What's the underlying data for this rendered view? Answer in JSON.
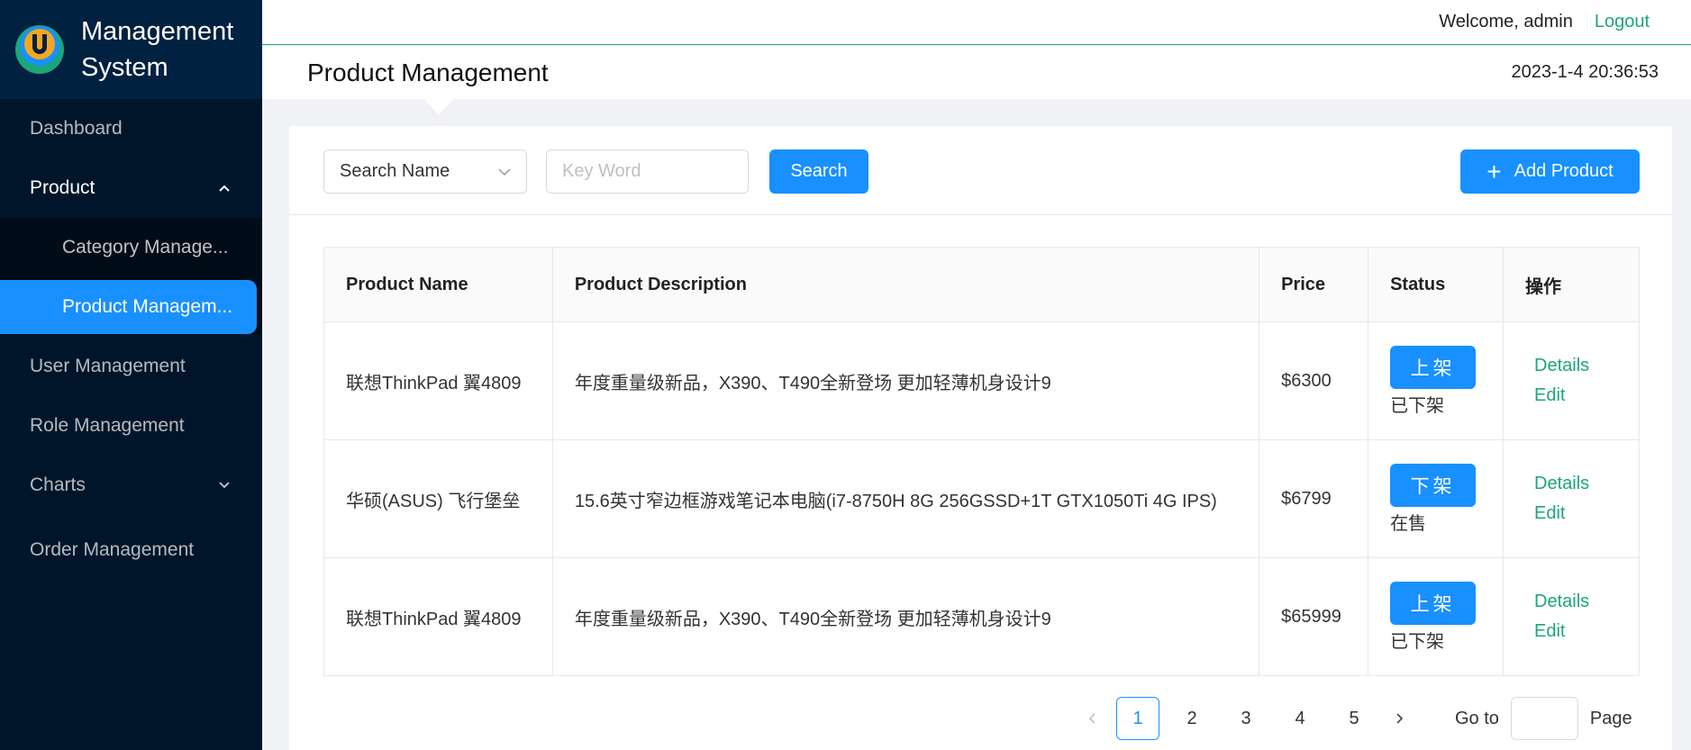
{
  "brand": {
    "title_line1": "Management",
    "title_line2": "System",
    "logo_icon": "u-logo-icon"
  },
  "sidebar": {
    "items": [
      {
        "label": "Dashboard"
      },
      {
        "label": "Product",
        "expanded": true,
        "children": [
          {
            "label": "Category Manage..."
          },
          {
            "label": "Product Managem...",
            "active": true
          }
        ]
      },
      {
        "label": "User Management"
      },
      {
        "label": "Role Management"
      },
      {
        "label": "Charts",
        "expanded": false
      },
      {
        "label": "Order Management"
      }
    ]
  },
  "header": {
    "welcome": "Welcome, admin",
    "logout": "Logout"
  },
  "titlebar": {
    "title": "Product Management",
    "datetime": "2023-1-4 20:36:53"
  },
  "toolbar": {
    "search_type": "Search Name",
    "keyword_placeholder": "Key Word",
    "search_label": "Search",
    "add_label": "Add Product",
    "add_icon": "plus-icon"
  },
  "table": {
    "headers": [
      "Product Name",
      "Product Description",
      "Price",
      "Status",
      "操作"
    ],
    "rows": [
      {
        "name": "联想ThinkPad 翼4809",
        "description": "年度重量级新品，X390、T490全新登场 更加轻薄机身设计9",
        "price": "$6300",
        "status_button": "上架",
        "status_text": "已下架",
        "details": "Details",
        "edit": "Edit"
      },
      {
        "name": "华硕(ASUS) 飞行堡垒",
        "description": "15.6英寸窄边框游戏笔记本电脑(i7-8750H 8G 256GSSD+1T GTX1050Ti 4G IPS)",
        "price": "$6799",
        "status_button": "下架",
        "status_text": "在售",
        "details": "Details",
        "edit": "Edit"
      },
      {
        "name": "联想ThinkPad 翼4809",
        "description": "年度重量级新品，X390、T490全新登场 更加轻薄机身设计9",
        "price": "$65999",
        "status_button": "上架",
        "status_text": "已下架",
        "details": "Details",
        "edit": "Edit"
      }
    ]
  },
  "pagination": {
    "pages": [
      "1",
      "2",
      "3",
      "4",
      "5"
    ],
    "current": "1",
    "goto_label": "Go to",
    "page_label": "Page"
  },
  "colors": {
    "primary": "#1890ff",
    "link_green": "#1da57a",
    "sidebar_bg": "#001529"
  }
}
